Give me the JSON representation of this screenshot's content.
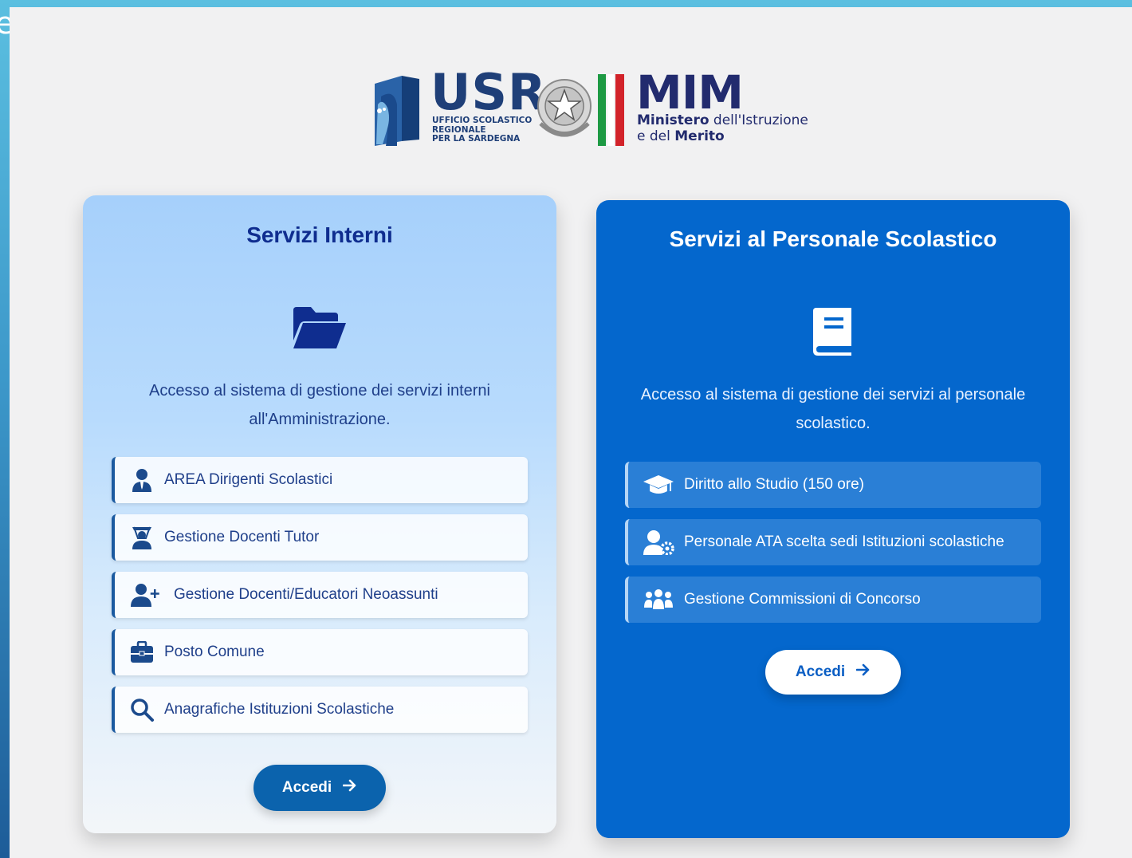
{
  "edge_glyph": "e",
  "header": {
    "usr_title": "USR",
    "usr_subtitle_lines": [
      "UFFICIO SCOLASTICO",
      "REGIONALE",
      "PER LA SARDEGNA"
    ],
    "mim_title": "MIM",
    "mim_line1_bold": "Ministero",
    "mim_line1_rest": " dell'Istruzione",
    "mim_line2_rest": "e del ",
    "mim_line2_bold": "Merito"
  },
  "cards": {
    "internal": {
      "title": "Servizi Interni",
      "icon": "folder-open-icon",
      "description": "Accesso al sistema di gestione dei servizi interni all'Amministrazione.",
      "items": [
        {
          "label": "AREA Dirigenti Scolastici",
          "icon": "user-tie-icon"
        },
        {
          "label": "Gestione Docenti Tutor",
          "icon": "chalkboard-teacher-icon"
        },
        {
          "label": "Gestione Docenti/Educatori Neoassunti",
          "icon": "user-plus-icon"
        },
        {
          "label": "Posto Comune",
          "icon": "briefcase-icon"
        },
        {
          "label": "Anagrafiche Istituzioni Scolastiche",
          "icon": "search-icon"
        }
      ],
      "button_label": "Accedi"
    },
    "staff": {
      "title": "Servizi al Personale Scolastico",
      "icon": "book-icon",
      "description": "Accesso al sistema di gestione dei servizi al personale scolastico.",
      "items": [
        {
          "label": "Diritto allo Studio (150 ore)",
          "icon": "graduation-cap-icon"
        },
        {
          "label": "Personale ATA scelta sedi Istituzioni scolastiche",
          "icon": "user-cog-icon"
        },
        {
          "label": "Gestione Commissioni di Concorso",
          "icon": "users-icon"
        }
      ],
      "button_label": "Accedi"
    }
  },
  "colors": {
    "internal_title": "#0f2d8f",
    "staff_card_bg": "#0467cd",
    "internal_button_bg": "#0b63ad"
  }
}
